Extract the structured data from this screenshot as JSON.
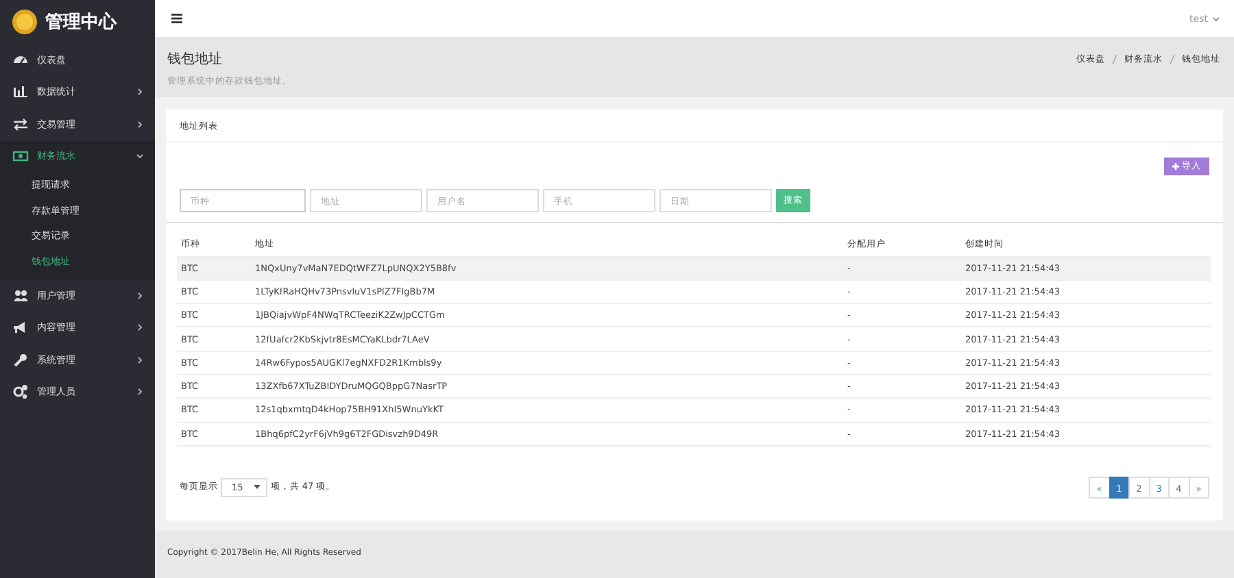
{
  "brand": {
    "title": "管理中心"
  },
  "sidebar": {
    "items": [
      {
        "label": "仪表盘",
        "expanded": false,
        "active": false
      },
      {
        "label": "数据统计",
        "expanded": false,
        "active": false
      },
      {
        "label": "交易管理",
        "expanded": false,
        "active": false
      },
      {
        "label": "财务流水",
        "expanded": true,
        "active": true,
        "children": [
          {
            "label": "提现请求",
            "selected": false
          },
          {
            "label": "存款单管理",
            "selected": false
          },
          {
            "label": "交易记录",
            "selected": false
          },
          {
            "label": "钱包地址",
            "selected": true
          }
        ]
      },
      {
        "label": "用户管理",
        "expanded": false,
        "active": false
      },
      {
        "label": "内容管理",
        "expanded": false,
        "active": false
      },
      {
        "label": "系统管理",
        "expanded": false,
        "active": false
      },
      {
        "label": "管理人员",
        "expanded": false,
        "active": false
      }
    ]
  },
  "topbar": {
    "user": "test"
  },
  "page_header": {
    "title": "钱包地址",
    "subtitle": "管理系统中的存款钱包地址。",
    "breadcrumb": [
      "仪表盘",
      "财务流水",
      "钱包地址"
    ]
  },
  "card": {
    "title": "地址列表",
    "import_button": "导入",
    "filters": [
      {
        "placeholder": "币种"
      },
      {
        "placeholder": "地址"
      },
      {
        "placeholder": "用户名"
      },
      {
        "placeholder": "手机"
      },
      {
        "placeholder": "日期"
      }
    ],
    "search_button": "搜索"
  },
  "table": {
    "columns": [
      "币种",
      "地址",
      "分配用户",
      "创建时间"
    ],
    "rows": [
      {
        "cells": [
          "BTC",
          "1NQxUny7vMaN7EDQtWFZ7LpUNQX2Y5B8fv",
          "-",
          "2017-11-21 21:54:43"
        ],
        "highlighted": true
      },
      {
        "cells": [
          "BTC",
          "1LTyKfRaHQHv73PnsvluV1sPlZ7FIgBb7M",
          "-",
          "2017-11-21 21:54:43"
        ],
        "highlighted": false
      },
      {
        "cells": [
          "BTC",
          "1JBQiajvWpF4NWqTRCTeeziK2ZwJpCCTGm",
          "-",
          "2017-11-21 21:54:43"
        ],
        "highlighted": false
      },
      {
        "cells": [
          "BTC",
          "12fUafcr2KbSkjvtr8EsMCYaKLbdr7LAeV",
          "-",
          "2017-11-21 21:54:43"
        ],
        "highlighted": false
      },
      {
        "cells": [
          "BTC",
          "14Rw6Fypos5AUGKl7egNXFD2R1Kmbls9y",
          "-",
          "2017-11-21 21:54:43"
        ],
        "highlighted": false
      },
      {
        "cells": [
          "BTC",
          "13ZXfb67XTuZBIDYDruMQGQBppG7NasrTP",
          "-",
          "2017-11-21 21:54:43"
        ],
        "highlighted": false
      },
      {
        "cells": [
          "BTC",
          "12s1qbxmtqD4kHop75BH91XhI5WnuYkKT",
          "-",
          "2017-11-21 21:54:43"
        ],
        "highlighted": false
      },
      {
        "cells": [
          "BTC",
          "1Bhq6pfC2yrF6jVh9g6T2FGDisvzh9D49R",
          "-",
          "2017-11-21 21:54:43"
        ],
        "highlighted": false
      }
    ]
  },
  "page_size": {
    "prefix": "每页显示",
    "value": "15",
    "suffix": "项，共 47 项。"
  },
  "pagination": [
    {
      "label": "«",
      "selected": false
    },
    {
      "label": "1",
      "selected": true
    },
    {
      "label": "2",
      "selected": false
    },
    {
      "label": "3",
      "selected": false
    },
    {
      "label": "4",
      "selected": false
    },
    {
      "label": "»",
      "selected": false
    }
  ],
  "footer": {
    "text": "Copyright © 2017Belin He, All Rights Reserved"
  }
}
